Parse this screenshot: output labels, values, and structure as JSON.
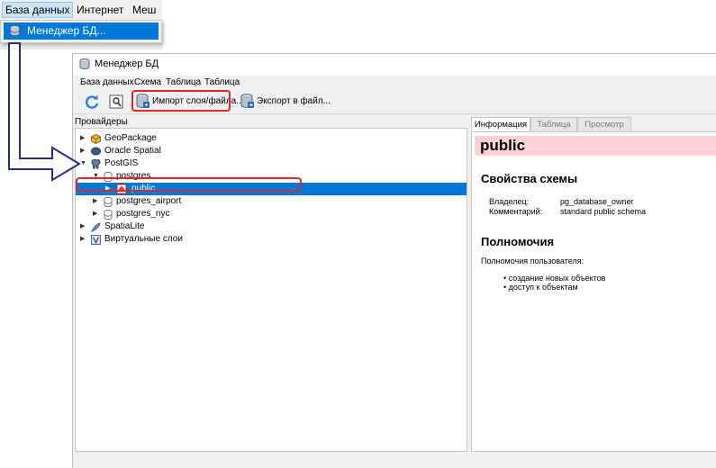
{
  "qgis": {
    "menu": [
      "База данных",
      "Интернет",
      "Меш"
    ],
    "dropdown_item": "Менеджер БД..."
  },
  "window": {
    "title": "Менеджер БД",
    "menu": [
      "База данных",
      "Схема",
      "Таблица",
      "Таблица"
    ],
    "toolbar": {
      "import_label": "Импорт слоя/файла...",
      "export_label": "Экспорт в файл..."
    }
  },
  "providers": {
    "label": "Провайдеры",
    "items": [
      "GeoPackage",
      "Oracle Spatial",
      "PostGIS",
      "postgres",
      "public",
      "postgres_airport",
      "postgres_nyc",
      "SpatiaLite",
      "Виртуальные слои"
    ]
  },
  "info": {
    "tabs": [
      "Информация",
      "Таблица",
      "Просмотр"
    ],
    "schema_name": "public",
    "props_heading": "Свойства схемы",
    "owner_label": "Владелец:",
    "owner_value": "pg_database_owner",
    "comment_label": "Комментарий:",
    "comment_value": "standard public schema",
    "perm_heading": "Полномочия",
    "perm_user_label": "Полномочия пользователя:",
    "permissions": [
      "создание новых объектов",
      "доступ к объектам"
    ]
  },
  "colors": {
    "highlight": "#e0262a",
    "selection": "#0078d7",
    "arrow": "#23308a",
    "schema_header": "#ffd3d3"
  }
}
